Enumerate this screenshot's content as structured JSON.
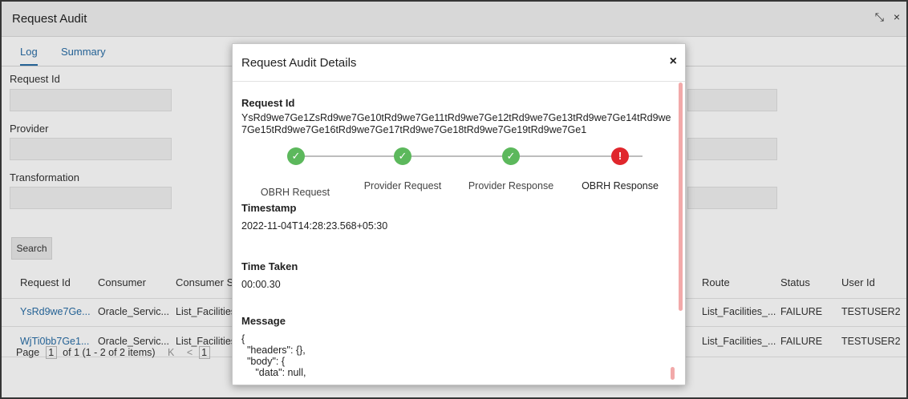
{
  "window": {
    "title": "Request Audit",
    "controls": [
      "⤡",
      "×"
    ]
  },
  "tabs": [
    {
      "label": "Log",
      "active": true
    },
    {
      "label": "Summary",
      "active": false
    }
  ],
  "filters": {
    "request_id_label": "Request Id",
    "provider_label": "Provider",
    "transformation_label": "Transformation",
    "search_label": "Search"
  },
  "table": {
    "headers": [
      "Request Id",
      "Consumer",
      "Consumer Ser",
      "Route",
      "Status",
      "User Id"
    ],
    "rows": [
      {
        "request_id": "YsRd9we7Ge...",
        "consumer": "Oracle_Servic...",
        "consumer_service": "List_Facilities",
        "route": "List_Facilities_...",
        "status": "FAILURE",
        "user_id": "TESTUSER2"
      },
      {
        "request_id": "WjTi0bb7Ge1...",
        "consumer": "Oracle_Servic...",
        "consumer_service": "List_Facilities",
        "route": "List_Facilities_...",
        "status": "FAILURE",
        "user_id": "TESTUSER2"
      }
    ]
  },
  "pager": {
    "page_label": "Page",
    "page_value": "1",
    "of_text": "of 1",
    "items_text": "(1 - 2 of 2 items)",
    "first": "K",
    "prev": "<",
    "current": "1"
  },
  "modal": {
    "title": "Request Audit Details",
    "close": "×",
    "request_id_label": "Request Id",
    "request_id_value": "YsRd9we7Ge1ZsRd9we7Ge10tRd9we7Ge11tRd9we7Ge12tRd9we7Ge13tRd9we7Ge14tRd9we7Ge15tRd9we7Ge16tRd9we7Ge17tRd9we7Ge18tRd9we7Ge19tRd9we7Ge1",
    "steps": [
      {
        "label": "OBRH Request",
        "status": "ok"
      },
      {
        "label": "Provider Request",
        "status": "ok"
      },
      {
        "label": "Provider Response",
        "status": "ok"
      },
      {
        "label": "OBRH Response",
        "status": "error"
      }
    ],
    "step_ok_glyph": "✓",
    "step_err_glyph": "!",
    "timestamp_label": "Timestamp",
    "timestamp_value": "2022-11-04T14:28:23.568+05:30",
    "time_taken_label": "Time Taken",
    "time_taken_value": "00:00.30",
    "message_label": "Message",
    "message_value": "{\n  \"headers\": {},\n  \"body\": {\n     \"data\": null,"
  }
}
